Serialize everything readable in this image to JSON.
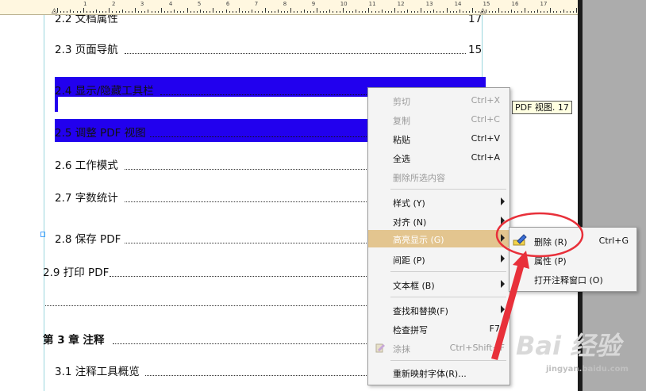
{
  "ruler": {
    "numbers": [
      "1",
      "2",
      "3",
      "4",
      "5",
      "6",
      "7",
      "8",
      "9",
      "10",
      "11",
      "12",
      "13",
      "14",
      "15",
      "16",
      "17"
    ]
  },
  "toc": {
    "entries": [
      {
        "label": "2.2 文档属性",
        "page": "17"
      },
      {
        "label": "2.3 页面导航",
        "page": "15"
      },
      {
        "label": "2.4 显示/隐藏工具栏",
        "page": ""
      },
      {
        "label": "2.5 调整 PDF 视图",
        "page": ""
      },
      {
        "label": "2.6 工作模式",
        "page": ""
      },
      {
        "label": "2.7 字数统计",
        "page": ""
      },
      {
        "label": "2.8 保存 PDF",
        "page": ""
      },
      {
        "label": "2.9 打印 PDF",
        "page": ""
      },
      {
        "label": "第 3 章  注释",
        "page": ""
      },
      {
        "label": "3.1 注释工具概览",
        "page": ""
      }
    ],
    "tooltip": "PDF 视图. 17",
    "highlight_color": "#2200ee"
  },
  "context_menu": {
    "cut": {
      "label": "剪切",
      "shortcut": "Ctrl+X"
    },
    "copy": {
      "label": "复制",
      "shortcut": "Ctrl+C"
    },
    "paste": {
      "label": "粘贴",
      "shortcut": "Ctrl+V"
    },
    "select_all": {
      "label": "全选",
      "shortcut": "Ctrl+A"
    },
    "delete_selection": {
      "label": "删除所选内容"
    },
    "style": {
      "label": "样式 (Y)"
    },
    "align": {
      "label": "对齐 (N)"
    },
    "highlight": {
      "label": "高亮显示 (G)"
    },
    "spacing": {
      "label": "间距 (P)"
    },
    "textbox": {
      "label": "文本框 (B)"
    },
    "find_replace": {
      "label": "查找和替换(F)"
    },
    "spellcheck": {
      "label": "检查拼写",
      "shortcut": "F7"
    },
    "smear": {
      "label": "涂抹",
      "shortcut": "Ctrl+Shift+F"
    },
    "remap_fonts": {
      "label": "重新映射字体(R)..."
    }
  },
  "highlight_submenu": {
    "delete": {
      "label": "删除 (R)",
      "shortcut": "Ctrl+G"
    },
    "properties": {
      "label": "属性 (P)"
    },
    "open_note": {
      "label": "打开注释窗口 (O)"
    }
  },
  "annotation_color": "#e8303a",
  "menu_hover_color": "#e3c58f",
  "watermark": {
    "logo_text": "Bai 经验",
    "url": "jingyan.baidu.com"
  }
}
